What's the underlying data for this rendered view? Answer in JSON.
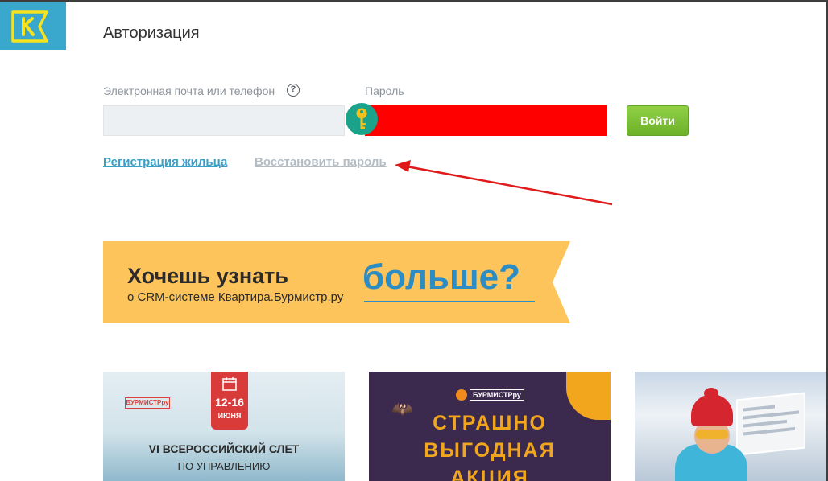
{
  "logo": {
    "letter": "K",
    "icon": "kvartira-logo-icon",
    "color": "#3aa7cc"
  },
  "page": {
    "title": "Авторизация"
  },
  "form": {
    "email_label": "Электронная почта или телефон",
    "email_value": "",
    "help_icon": "question-circle-icon",
    "help_symbol": "?",
    "password_label": "Пароль",
    "password_value": "",
    "password_highlight_color": "#ff0000",
    "key_icon": "key-icon",
    "login_button": "Войти"
  },
  "links": {
    "register": "Регистрация жильца",
    "restore_password": "Восстановить пароль"
  },
  "annotation": {
    "arrow_color": "#e0191b",
    "icon": "red-arrow-annotation"
  },
  "banner": {
    "heading": "Хочешь узнать",
    "subtitle": "о CRM-системе Квартира.Бурмистр.ру",
    "more": "больше?",
    "background": "#fdc45b"
  },
  "cards": [
    {
      "logo": "БУРМИСТРру",
      "date_days": "12-16",
      "date_month": "ИЮНЯ",
      "title": "VI ВСЕРОССИЙСКИЙ СЛЕТ",
      "subtitle": "ПО УПРАВЛЕНИЮ"
    },
    {
      "logo": "БУРМИСТРру",
      "line1": "СТРАШНО",
      "line2": "ВЫГОДНАЯ",
      "line3": "АКЦИЯ"
    },
    {
      "image": "skier-with-screens"
    }
  ]
}
